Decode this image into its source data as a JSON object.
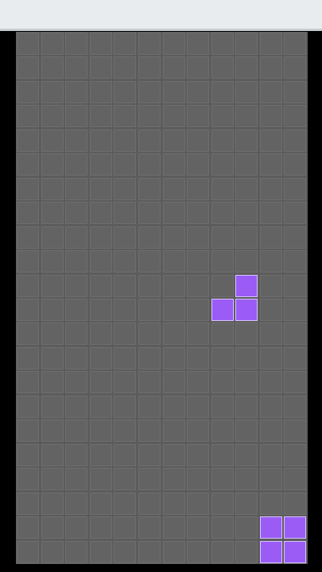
{
  "game": {
    "title": "",
    "colors": {
      "background": "#000000",
      "board": "#5c5c5c",
      "cell_empty": "#636363",
      "cell_border": "#6e6e6e",
      "piece": "#9b5cf6",
      "piece_border": "#d7c4ff",
      "topbar": "#e8ecef"
    },
    "grid": {
      "columns": 12,
      "rows": 22
    },
    "active_piece": {
      "color": "#9b5cf6",
      "cells": [
        {
          "col": 9,
          "row": 10
        },
        {
          "col": 8,
          "row": 11
        },
        {
          "col": 9,
          "row": 11
        }
      ]
    },
    "locked_blocks": [
      {
        "col": 10,
        "row": 20,
        "color": "#9b5cf6"
      },
      {
        "col": 11,
        "row": 20,
        "color": "#9b5cf6"
      },
      {
        "col": 10,
        "row": 21,
        "color": "#9b5cf6"
      },
      {
        "col": 11,
        "row": 21,
        "color": "#9b5cf6"
      }
    ]
  }
}
